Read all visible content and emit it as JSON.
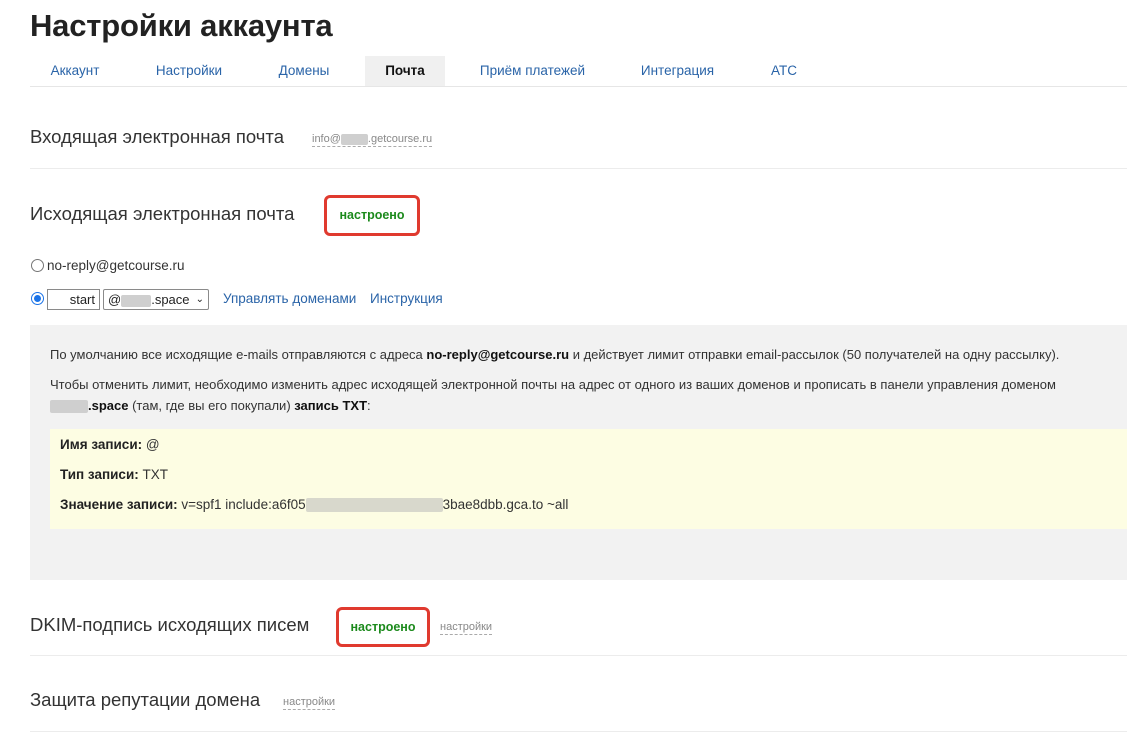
{
  "page": {
    "title": "Настройки аккаунта"
  },
  "tabs": [
    {
      "label": "Аккаунт",
      "active": false
    },
    {
      "label": "Настройки",
      "active": false
    },
    {
      "label": "Домены",
      "active": false
    },
    {
      "label": "Почта",
      "active": true
    },
    {
      "label": "Приём платежей",
      "active": false
    },
    {
      "label": "Интеграция",
      "active": false
    },
    {
      "label": "АТС",
      "active": false
    }
  ],
  "incoming": {
    "title": "Входящая электронная почта",
    "email_prefix": "info@",
    "email_suffix": ".getcourse.ru"
  },
  "outgoing": {
    "title": "Исходящая электронная почта",
    "status": "настроено",
    "option_default": "no-reply@getcourse.ru",
    "input_value": "start",
    "domain_prefix": "@",
    "domain_suffix": ".space",
    "manage_domains_link": "Управлять доменами",
    "instruction_link": "Инструкция"
  },
  "info": {
    "p1_before": "По умолчанию все исходящие e-mails отправляются с адреса ",
    "p1_bold": "no-reply@getcourse.ru",
    "p1_after": " и действует лимит отправки email-рассылок (50 получателей на одну рассылку).",
    "p2_line1": "Чтобы отменить лимит, необходимо изменить адрес исходящей электронной почты на адрес от одного из ваших доменов   и прописать в панели управления доменом",
    "p2_domain_suffix": ".space",
    "p2_middle": " (там, где вы его покупали) ",
    "p2_bold": "запись TXT",
    "p2_end": ":",
    "record": {
      "name_label": "Имя записи:",
      "name_value": " @",
      "type_label": "Тип записи:",
      "type_value": " TXT",
      "value_label": "Значение записи:",
      "value_prefix": " v=spf1 include:a6f05",
      "value_suffix": "3bae8dbb.gca.to ~all"
    }
  },
  "dkim": {
    "title": "DKIM-подпись исходящих писем",
    "status": "настроено",
    "settings_link": "настройки"
  },
  "reputation": {
    "title": "Защита репутации домена",
    "settings_link": "настройки"
  },
  "colors": {
    "accent_link": "#2a64a8",
    "status_green": "#1c8a1c",
    "highlight_red": "#e03a2f",
    "record_bg": "#fdfde3"
  }
}
